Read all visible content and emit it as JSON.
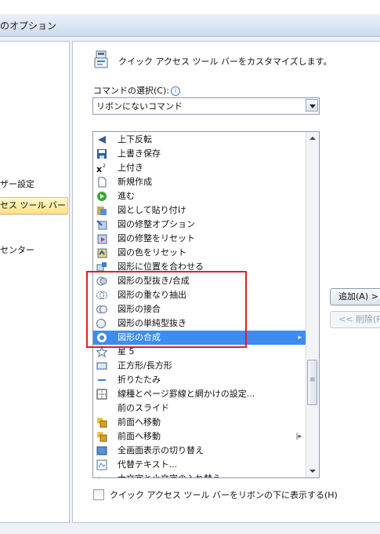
{
  "window": {
    "title": "のオプション"
  },
  "nav": {
    "items": [
      {
        "label": "ザー設定"
      },
      {
        "label": "セス ツール バー"
      },
      {
        "label": "センター"
      }
    ]
  },
  "main": {
    "heading": "クイック アクセス ツール バーをカスタマイズします。",
    "choose_label": "コマンドの選択(C):",
    "choose_value": "リボンにないコマンド",
    "commands": [
      {
        "label": "上下反転",
        "icon": "flip-icon"
      },
      {
        "label": "上書き保存",
        "icon": "save-icon"
      },
      {
        "label": "上付き",
        "icon": "superscript-icon"
      },
      {
        "label": "新規作成",
        "icon": "new-doc-icon"
      },
      {
        "label": "進む",
        "icon": "forward-icon"
      },
      {
        "label": "図として貼り付け",
        "icon": "paste-picture-icon"
      },
      {
        "label": "図の修整オプション",
        "icon": "picture-options-icon"
      },
      {
        "label": "図の修整をリセット",
        "icon": "reset-picture-icon"
      },
      {
        "label": "図の色をリセット",
        "icon": "reset-color-icon"
      },
      {
        "label": "図形に位置を合わせる",
        "icon": "snap-shape-icon"
      },
      {
        "label": "図形の型抜き/合成",
        "icon": "shape-combine-icon"
      },
      {
        "label": "図形の重なり抽出",
        "icon": "shape-intersect-icon"
      },
      {
        "label": "図形の接合",
        "icon": "shape-union-icon"
      },
      {
        "label": "図形の単純型抜き",
        "icon": "shape-subtract-icon"
      },
      {
        "label": "図形の合成",
        "icon": "shape-merge-icon",
        "selected": true,
        "submenu": "▸"
      },
      {
        "label": "星 5",
        "icon": "star-icon"
      },
      {
        "label": "正方形/長方形",
        "icon": "rectangle-icon"
      },
      {
        "label": "折りたたみ",
        "icon": "collapse-icon"
      },
      {
        "label": "線種とページ罫線と網かけの設定...",
        "icon": "borders-icon"
      },
      {
        "label": "前のスライド",
        "icon": ""
      },
      {
        "label": "前面へ移動",
        "icon": "bring-forward-icon"
      },
      {
        "label": "前面へ移動",
        "icon": "bring-forward-icon",
        "submenu": "|▸"
      },
      {
        "label": "全画面表示の切り替え",
        "icon": "fullscreen-icon"
      },
      {
        "label": "代替テキスト...",
        "icon": "alt-text-icon"
      },
      {
        "label": "大文字と小文字の入れ替え",
        "icon": "change-case-icon"
      }
    ],
    "add_label": "追加(A) >",
    "remove_label": "<< 削除(R)",
    "below_ribbon_label": "クイック アクセス ツール バーをリボンの下に表示する(H)"
  },
  "colors": {
    "selection": "#3f8cf0",
    "highlight_box": "#e02020",
    "nav_selected": "#ffe38a"
  }
}
